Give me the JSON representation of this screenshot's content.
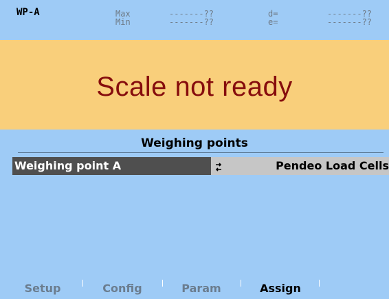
{
  "header": {
    "title": "WP-A",
    "max_label": "Max",
    "min_label": "Min",
    "max_value": "-------??",
    "min_value": "-------??",
    "d_label": "d=",
    "e_label": "e=",
    "d_value": "-------??",
    "e_value": "-------??"
  },
  "status": {
    "message": "Scale not ready",
    "background": "#f9cf7b",
    "text_color": "#860d0d"
  },
  "section": {
    "title": "Weighing points"
  },
  "weighing_points": [
    {
      "name": "Weighing point A",
      "value": "Pendeo Load Cells",
      "icon": "swap-arrows-icon"
    }
  ],
  "tabs": [
    {
      "label": "Setup",
      "active": false
    },
    {
      "label": "Config",
      "active": false
    },
    {
      "label": "Param",
      "active": false
    },
    {
      "label": "Assign",
      "active": true
    }
  ],
  "colors": {
    "background": "#9ecbf6",
    "selected_row": "#4f4f4f",
    "row_value_bg": "#c6c6c6",
    "inactive_tab": "#6b7d8f"
  }
}
